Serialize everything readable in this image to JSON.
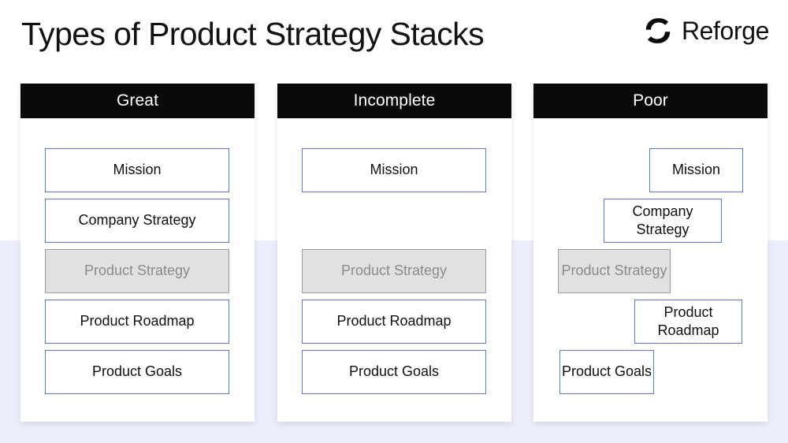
{
  "header": {
    "title": "Types of Product Strategy Stacks",
    "brand_name": "Reforge",
    "brand_logo_icon": "reforge-logo-icon"
  },
  "theme": {
    "background_top": "#ffffff",
    "background_bottom": "#eceefb",
    "card_background": "#ffffff",
    "card_header_background": "#0a0a0a",
    "card_header_text": "#ffffff",
    "box_border_blue": "#5b78cd",
    "box_border_gray": "#9d9d99",
    "box_fill_gray": "#e1e1df",
    "box_text": "#101010",
    "box_text_muted": "#8b8b8b"
  },
  "columns": [
    {
      "id": "great",
      "header": "Great",
      "layout": "aligned",
      "boxes": [
        {
          "label": "Mission",
          "state": "normal"
        },
        {
          "label": "Company Strategy",
          "state": "normal"
        },
        {
          "label": "Product Strategy",
          "state": "muted"
        },
        {
          "label": "Product Roadmap",
          "state": "normal"
        },
        {
          "label": "Product Goals",
          "state": "normal"
        }
      ]
    },
    {
      "id": "incomplete",
      "header": "Incomplete",
      "layout": "aligned-with-gap",
      "boxes": [
        {
          "label": "Mission",
          "state": "normal"
        },
        {
          "label": "",
          "state": "missing"
        },
        {
          "label": "Product Strategy",
          "state": "muted"
        },
        {
          "label": "Product Roadmap",
          "state": "normal"
        },
        {
          "label": "Product Goals",
          "state": "normal"
        }
      ]
    },
    {
      "id": "poor",
      "header": "Poor",
      "layout": "staggered",
      "boxes": [
        {
          "label": "Mission",
          "state": "normal"
        },
        {
          "label": "Company Strategy",
          "state": "normal"
        },
        {
          "label": "Product Strategy",
          "state": "muted"
        },
        {
          "label": "Product Roadmap",
          "state": "normal"
        },
        {
          "label": "Product Goals",
          "state": "normal"
        }
      ]
    }
  ]
}
